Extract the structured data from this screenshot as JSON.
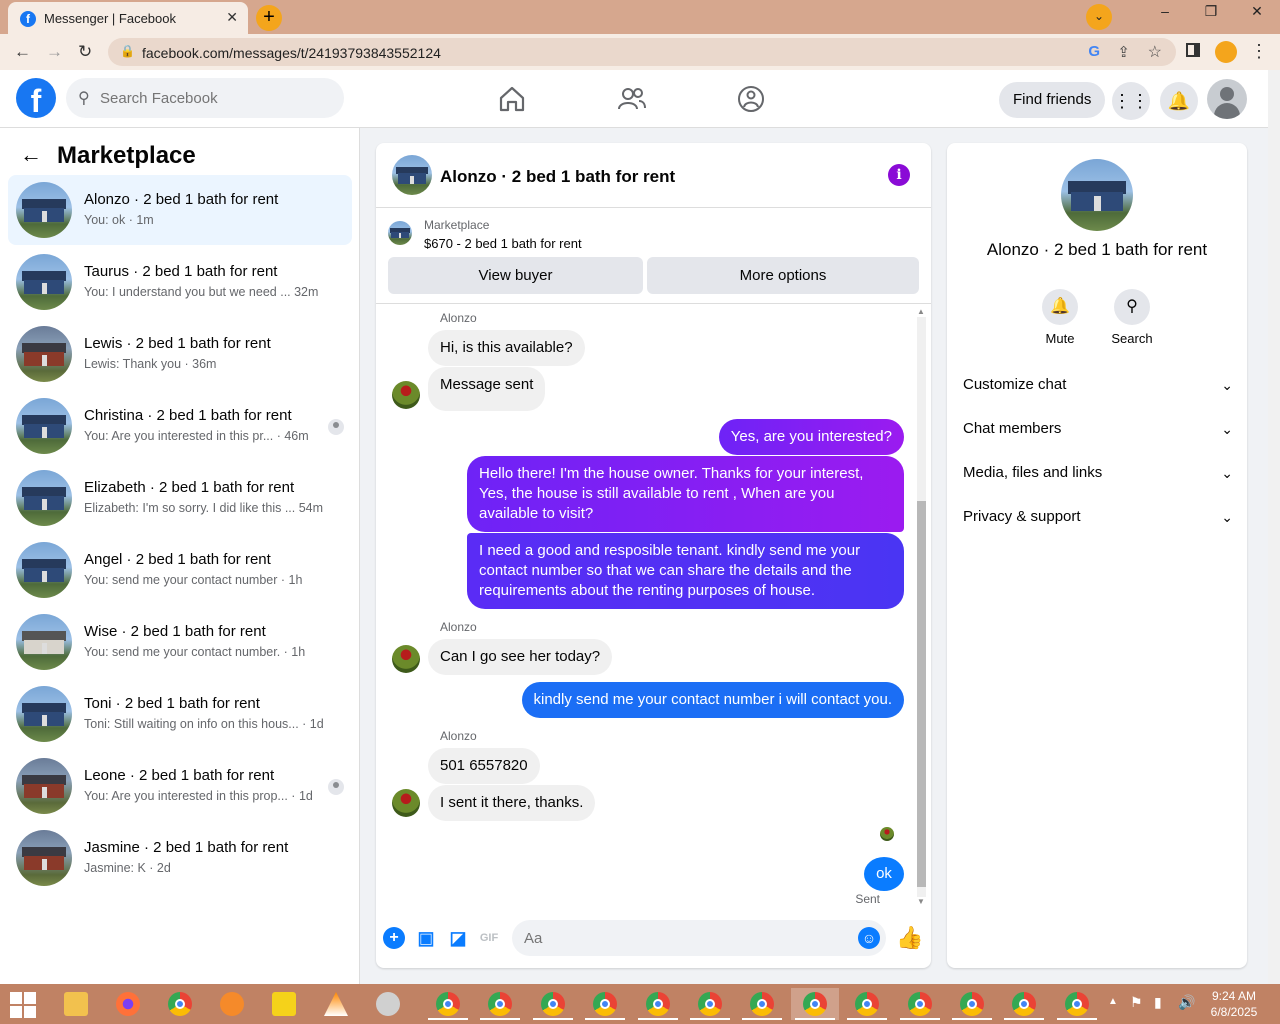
{
  "browser": {
    "tab_title": "Messenger | Facebook",
    "url": "facebook.com/messages/t/24193793843552124"
  },
  "header": {
    "search_placeholder": "Search Facebook",
    "find_friends": "Find friends"
  },
  "sidebar": {
    "title": "Marketplace",
    "conversations": [
      {
        "name": "Alonzo · 2 bed 1 bath for rent",
        "snippet": "You: ok · 1m",
        "thumb": "house-blue",
        "active": true,
        "muted": false
      },
      {
        "name": "Taurus · 2 bed 1 bath for rent",
        "snippet": "You: I understand you but we need ...  32m",
        "thumb": "house-blue",
        "muted": false
      },
      {
        "name": "Lewis · 2 bed 1 bath for rent",
        "snippet": "Lewis: Thank you · 36m",
        "thumb": "house-brick",
        "muted": false
      },
      {
        "name": "Christina · 2 bed 1 bath for rent",
        "snippet": "You: Are you interested in this pr... · 46m",
        "thumb": "house-blue",
        "muted": true
      },
      {
        "name": "Elizabeth · 2 bed 1 bath for rent",
        "snippet": "Elizabeth: I'm so sorry. I did like this ...  54m",
        "thumb": "house-blue",
        "muted": false
      },
      {
        "name": "Angel · 2 bed 1 bath for rent",
        "snippet": "You: send me your contact number · 1h",
        "thumb": "house-blue",
        "muted": false
      },
      {
        "name": "Wise · 2 bed 1 bath for rent",
        "snippet": "You: send me your contact number. · 1h",
        "thumb": "house-white",
        "muted": false
      },
      {
        "name": "Toni · 2 bed 1 bath for rent",
        "snippet": "Toni: Still waiting on info on this hous... · 1d",
        "thumb": "house-blue",
        "muted": false
      },
      {
        "name": "Leone · 2 bed 1 bath for rent",
        "snippet": "You: Are you interested in this prop... · 1d",
        "thumb": "house-brick",
        "muted": true
      },
      {
        "name": "Jasmine · 2 bed 1 bath for rent",
        "snippet": "Jasmine: K · 2d",
        "thumb": "house-brick",
        "muted": false
      }
    ]
  },
  "chat": {
    "title": "Alonzo · 2 bed 1 bath for rent",
    "marketplace_label": "Marketplace",
    "listing": "$670 - 2 bed 1 bath for rent",
    "view_buyer": "View buyer",
    "more_options": "More options",
    "messages": [
      {
        "sender": "Alonzo"
      },
      {
        "from": "them",
        "text": "Hi, is this available?"
      },
      {
        "from": "them",
        "text": "Message sent"
      },
      {
        "from": "me",
        "text": "Yes, are you interested?"
      },
      {
        "from": "me",
        "text": "Hello there! I'm the house owner. Thanks for your interest, Yes, the house is still available to rent , When are you available to visit?"
      },
      {
        "from": "me",
        "text": "I need a good and resposible tenant.  kindly send me your contact number so that we can share the details and the requirements about the renting purposes of house."
      },
      {
        "sender": "Alonzo"
      },
      {
        "from": "them",
        "text": "Can I go see her today?"
      },
      {
        "from": "me",
        "text": "kindly send me your contact number i will contact you."
      },
      {
        "sender": "Alonzo"
      },
      {
        "from": "them",
        "text": "501 6557820"
      },
      {
        "from": "them",
        "text": "I sent it there, thanks."
      },
      {
        "from": "me",
        "text": "ok"
      }
    ],
    "status": "Sent",
    "input_placeholder": "Aa"
  },
  "details": {
    "title": "Alonzo · 2 bed 1 bath for rent",
    "mute": "Mute",
    "search": "Search",
    "sections": [
      "Customize chat",
      "Chat members",
      "Media, files and links",
      "Privacy & support"
    ]
  },
  "taskbar": {
    "time": "9:24 AM",
    "date": "6/8/2025"
  },
  "colors": {
    "fb_blue": "#1877f2",
    "bubble_purple": "#8a1cf2",
    "bubble_blue": "#0a7cff",
    "tab_bar": "#d6a78e",
    "taskbar": "#c08264"
  }
}
